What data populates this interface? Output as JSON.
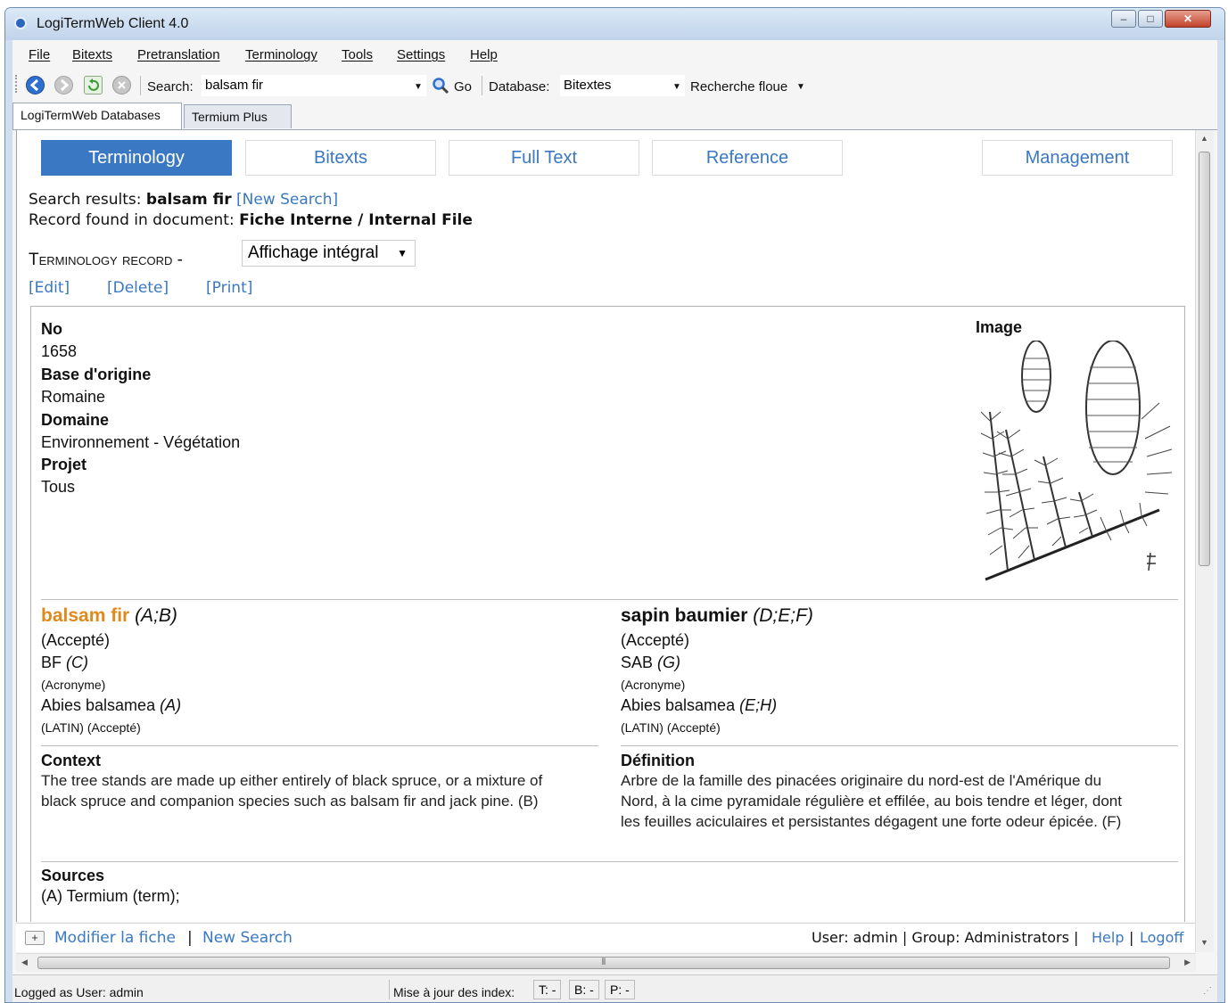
{
  "window": {
    "title": "LogiTermWeb Client 4.0"
  },
  "menu": [
    "File",
    "Bitexts",
    "Pretranslation",
    "Terminology",
    "Tools",
    "Settings",
    "Help"
  ],
  "toolbar": {
    "search_label": "Search:",
    "search_value": "balsam fir",
    "go": "Go",
    "database_label": "Database:",
    "database_value": "Bitextes",
    "fuzzy": "Recherche floue"
  },
  "tabs": [
    "LogiTermWeb Databases",
    "Termium Plus"
  ],
  "nav_tabs": [
    "Terminology",
    "Bitexts",
    "Full Text",
    "Reference",
    "Management"
  ],
  "header": {
    "results_prefix": "Search results:",
    "query": "balsam fir",
    "new_search": "[New Search]",
    "found_prefix": "Record found in document:",
    "document": "Fiche Interne / Internal File",
    "record_label": "Terminology record -",
    "display_mode": "Affichage intégral",
    "edit": "[Edit]",
    "delete": "[Delete]",
    "print": "[Print]"
  },
  "record": {
    "no_label": "No",
    "no": "1658",
    "base_label": "Base d'origine",
    "base": "Romaine",
    "domain_label": "Domaine",
    "domain": "Environnement - Végétation",
    "project_label": "Projet",
    "project": "Tous",
    "image_label": "Image"
  },
  "terms_en": {
    "main": "balsam fir",
    "main_src": "(A;B)",
    "main_status": "(Accepté)",
    "t2": "BF",
    "t2_src": "(C)",
    "t2_note": "(Acronyme)",
    "t3": "Abies balsamea",
    "t3_src": "(A)",
    "t3_note": "(LATIN) (Accepté)"
  },
  "terms_fr": {
    "main": "sapin baumier",
    "main_src": "(D;E;F)",
    "main_status": "(Accepté)",
    "t2": "SAB",
    "t2_src": "(G)",
    "t2_note": "(Acronyme)",
    "t3": "Abies balsamea",
    "t3_src": "(E;H)",
    "t3_note": "(LATIN) (Accepté)"
  },
  "context": {
    "label": "Context",
    "line1": "The tree stands are made up either entirely of black spruce, or a mixture of",
    "line2": "black spruce and companion species such as balsam fir and jack pine. (B)"
  },
  "definition": {
    "label": "Définition",
    "line1": "Arbre de la famille des pinacées originaire du nord-est de l'Amérique du",
    "line2": "Nord, à la cime pyramidale régulière et effilée, au bois tendre et léger, dont",
    "line3": "les feuilles aciculaires et persistantes dégagent une forte odeur épicée. (F)"
  },
  "sources": {
    "label": "Sources",
    "line1": "(A) Termium (term);"
  },
  "footer": {
    "modify": "Modifier la fiche",
    "sep": "|",
    "new_search": "New Search",
    "user": "User: admin | Group: Administrators |",
    "help": "Help",
    "pipe": "|",
    "logoff": "Logoff"
  },
  "status": {
    "logged": "Logged as User: admin",
    "index_label": "Mise à jour des index:",
    "t": "T: -",
    "b": "B: -",
    "p": "P: -"
  }
}
